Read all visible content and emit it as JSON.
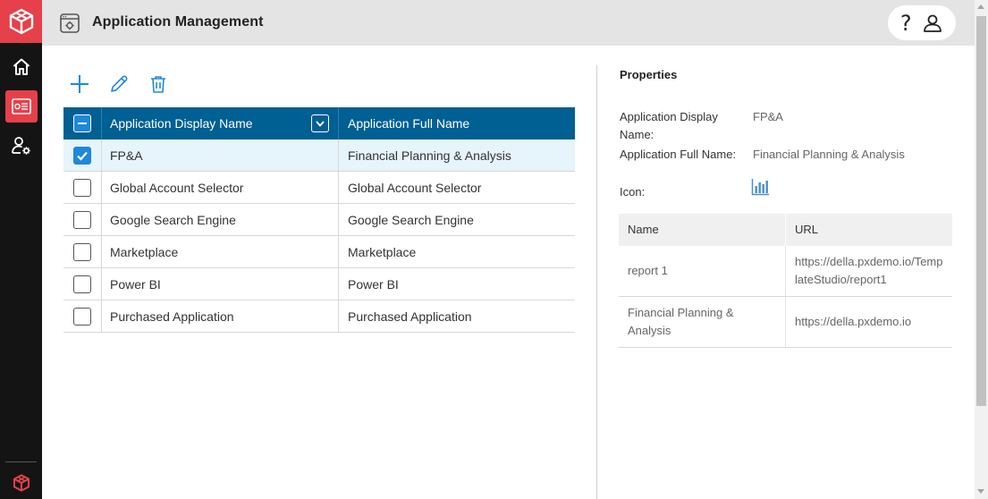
{
  "header": {
    "title": "Application Management",
    "help_label": "?"
  },
  "toolbar": {
    "add_icon": "plus-icon",
    "edit_icon": "pencil-icon",
    "delete_icon": "trash-icon"
  },
  "grid": {
    "columns": [
      "Application Display Name",
      "Application Full Name"
    ],
    "rows": [
      {
        "display": "FP&A",
        "full": "Financial Planning & Analysis",
        "checked": true
      },
      {
        "display": "Global Account Selector",
        "full": "Global Account Selector",
        "checked": false
      },
      {
        "display": "Google Search Engine",
        "full": "Google Search Engine",
        "checked": false
      },
      {
        "display": "Marketplace",
        "full": "Marketplace",
        "checked": false
      },
      {
        "display": "Power BI",
        "full": "Power BI",
        "checked": false
      },
      {
        "display": "Purchased Application",
        "full": "Purchased Application",
        "checked": false
      }
    ]
  },
  "properties": {
    "title": "Properties",
    "display_name_label": "Application Display Name:",
    "display_name_value": "FP&A",
    "full_name_label": "Application Full Name:",
    "full_name_value": "Financial Planning & Analysis",
    "icon_label": "Icon:",
    "icon_name": "bar-chart-icon",
    "urls": {
      "columns": [
        "Name",
        "URL"
      ],
      "rows": [
        {
          "name": "report 1",
          "url": "https://della.pxdemo.io/TemplateStudio/report1"
        },
        {
          "name": "Financial Planning & Analysis",
          "url": "https://della.pxdemo.io"
        }
      ]
    }
  },
  "colors": {
    "brand_red": "#e6404a",
    "grid_header": "#005f93",
    "accent_blue": "#1e88d9",
    "selected_row": "#e6f4fb"
  }
}
